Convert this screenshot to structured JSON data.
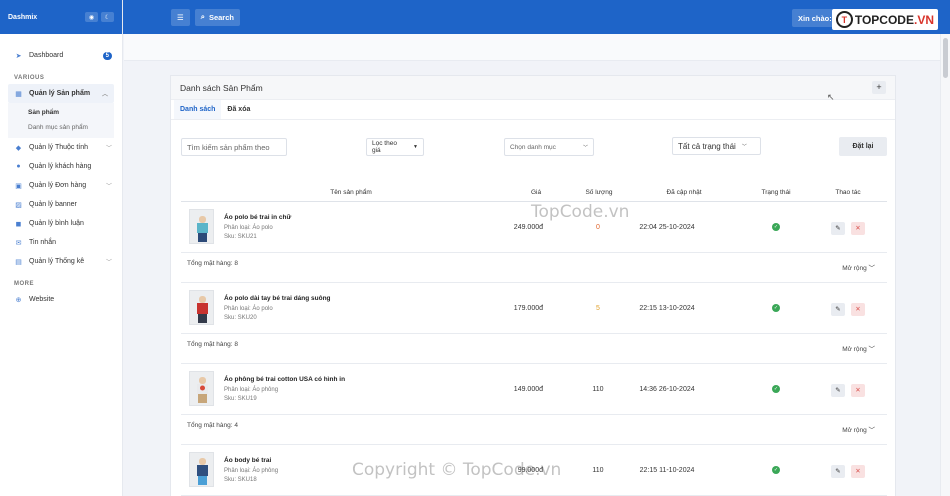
{
  "app": {
    "brand": "Dashmix"
  },
  "sidebar": {
    "items": [
      {
        "label": "Dashboard",
        "badge": "5"
      }
    ],
    "section_various": "VARIOUS",
    "products_group": {
      "label": "Quản lý Sản phẩm",
      "sub": [
        "Sản phẩm",
        "Danh mục sản phẩm"
      ]
    },
    "various_items": [
      {
        "label": "Quản lý Thuộc tính"
      },
      {
        "label": "Quản lý khách hàng"
      },
      {
        "label": "Quản lý Đơn hàng"
      },
      {
        "label": "Quản lý banner"
      },
      {
        "label": "Quản lý bình luận"
      },
      {
        "label": "Tin nhắn"
      },
      {
        "label": "Quản lý Thống kê"
      }
    ],
    "section_more": "MORE",
    "more_items": [
      {
        "label": "Website"
      }
    ]
  },
  "topbar": {
    "search_label": "Search",
    "greeting": "Xin chào: Huy"
  },
  "logo": {
    "text_main": "TOPCODE",
    "text_tld": ".VN"
  },
  "card": {
    "title": "Danh sách Sản Phẩm",
    "plus": "+",
    "tabs": [
      "Danh sách",
      "Đã xóa"
    ]
  },
  "filters": {
    "search_placeholder": "Tìm kiếm sản phẩm theo",
    "price_filter": "Lọc theo giá",
    "category": "Chọn danh mục",
    "status": "Tất cả trạng thái",
    "reset": "Đặt lại"
  },
  "table": {
    "headers": [
      "Tên sản phẩm",
      "Giá",
      "Số lượng",
      "Đã cập nhật",
      "Trạng thái",
      "Thao tác"
    ],
    "rows": [
      {
        "name": "Áo polo bé trai in chữ",
        "category": "Phân loại: Áo polo",
        "sku": "Sku: SKU21",
        "price": "249.000đ",
        "qty": "0",
        "qty_color": "#e0642c",
        "updated": "22:04 25-10-2024",
        "summary": "Tổng mặt hàng: 8",
        "expand": "Mở rộng"
      },
      {
        "name": "Áo polo dài tay bé trai dáng suông",
        "category": "Phân loại: Áo polo",
        "sku": "Sku: SKU20",
        "price": "179.000đ",
        "qty": "5",
        "qty_color": "#e0a02c",
        "updated": "22:15 13-10-2024",
        "summary": "Tổng mặt hàng: 8",
        "expand": "Mở rộng"
      },
      {
        "name": "Áo phông bé trai cotton USA có hình in",
        "category": "Phân loại: Áo phông",
        "sku": "Sku: SKU19",
        "price": "149.000đ",
        "qty": "110",
        "qty_color": "#333333",
        "updated": "14:36 26-10-2024",
        "summary": "Tổng mặt hàng: 4",
        "expand": "Mở rộng"
      },
      {
        "name": "Áo body bé trai",
        "category": "Phân loại: Áo phông",
        "sku": "Sku: SKU18",
        "price": "99.000đ",
        "qty": "110",
        "qty_color": "#333333",
        "updated": "22:15 11-10-2024"
      }
    ]
  },
  "watermarks": {
    "mid": "TopCode.vn",
    "bottom": "Copyright © TopCode.vn"
  }
}
